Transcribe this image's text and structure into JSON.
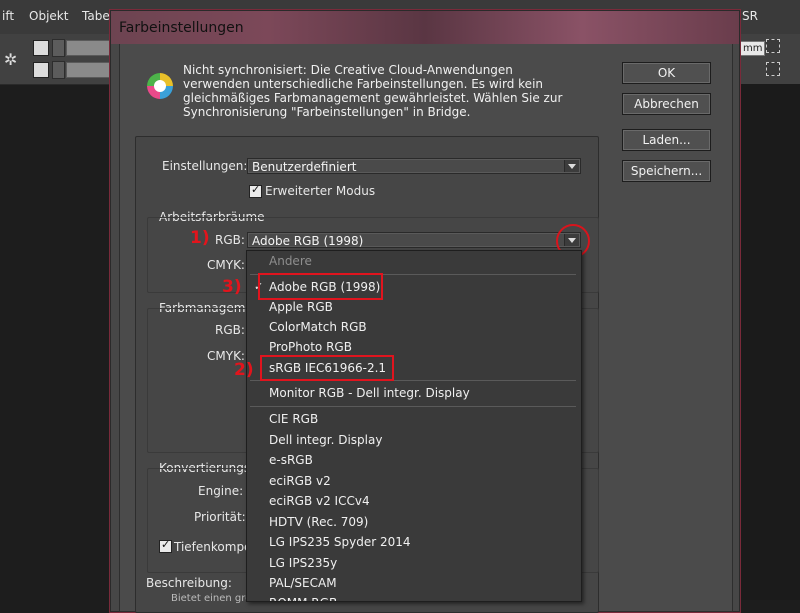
{
  "app": {
    "menu": [
      "ift",
      "Objekt",
      "Tabel"
    ],
    "menu_right": "SR",
    "unit": "mm"
  },
  "dialog": {
    "title": "Farbeinstellungen",
    "sync_message": "Nicht synchronisiert: Die Creative Cloud-Anwendungen verwenden unterschiedliche Farbeinstellungen. Es wird kein gleichmäßiges Farbmanagement gewährleistet. Wählen Sie zur Synchronisierung \"Farbeinstellungen\" in Bridge.",
    "buttons": {
      "ok": "OK",
      "cancel": "Abbrechen",
      "load": "Laden...",
      "save": "Speichern..."
    },
    "settings_label": "Einstellungen:",
    "settings_value": "Benutzerdefiniert",
    "advanced_mode_label": "Erweiterter Modus",
    "advanced_mode_checked": true,
    "working_spaces": {
      "title": "Arbeitsfarbräume",
      "rgb_label": "RGB:",
      "rgb_value": "Adobe RGB (1998)",
      "cmyk_label": "CMYK:"
    },
    "color_management": {
      "title": "Farbmanageme",
      "rgb_label": "RGB:",
      "cmyk_label": "CMYK:"
    },
    "conversion": {
      "title": "Konvertierungso",
      "engine_label": "Engine:",
      "priority_label": "Priorität:",
      "depth_label": "Tiefenkompe",
      "depth_checked": true
    },
    "description_label": "Beschreibung:",
    "description_text": "Bietet einen größ"
  },
  "rgb_list": {
    "header": "Andere",
    "selected": "Adobe RGB (1998)",
    "group1": [
      "Adobe RGB (1998)",
      "Apple RGB",
      "ColorMatch RGB",
      "ProPhoto RGB",
      "sRGB IEC61966-2.1"
    ],
    "monitor": "Monitor RGB - Dell integr. Display",
    "group2": [
      "CIE RGB",
      "Dell integr. Display",
      "e-sRGB",
      "eciRGB v2",
      "eciRGB v2 ICCv4",
      "HDTV (Rec. 709)",
      "LG IPS235 Spyder 2014",
      "LG IPS235y",
      "PAL/SECAM",
      "ROMM RGB"
    ]
  },
  "annotations": {
    "step1": "1)",
    "step2": "2)",
    "step3": "3)",
    "color": "#e0141e"
  }
}
